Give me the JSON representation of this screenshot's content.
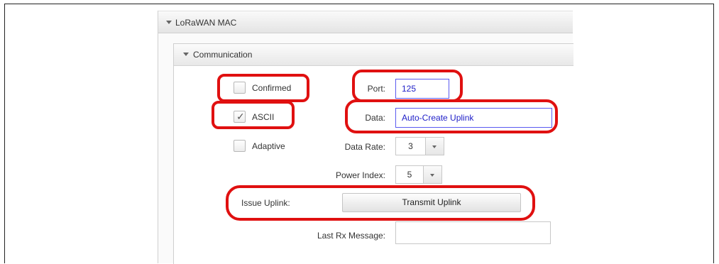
{
  "mac_section": {
    "title": "LoRaWAN MAC"
  },
  "communication": {
    "title": "Communication",
    "confirmed": {
      "label": "Confirmed",
      "checked": false
    },
    "ascii": {
      "label": "ASCII",
      "checked": true,
      "mark": "✓"
    },
    "adaptive": {
      "label": "Adaptive",
      "checked": false
    },
    "port": {
      "label": "Port:",
      "value": "125"
    },
    "data": {
      "label": "Data:",
      "value": "Auto-Create Uplink"
    },
    "data_rate": {
      "label": "Data Rate:",
      "value": "3"
    },
    "power_index": {
      "label": "Power Index:",
      "value": "5"
    },
    "issue_uplink": {
      "label": "Issue Uplink:",
      "button": "Transmit Uplink"
    },
    "last_rx": {
      "label": "Last Rx Message:",
      "value": ""
    }
  },
  "annotation_color": "#e01010",
  "focus_color": "#5a5af0"
}
